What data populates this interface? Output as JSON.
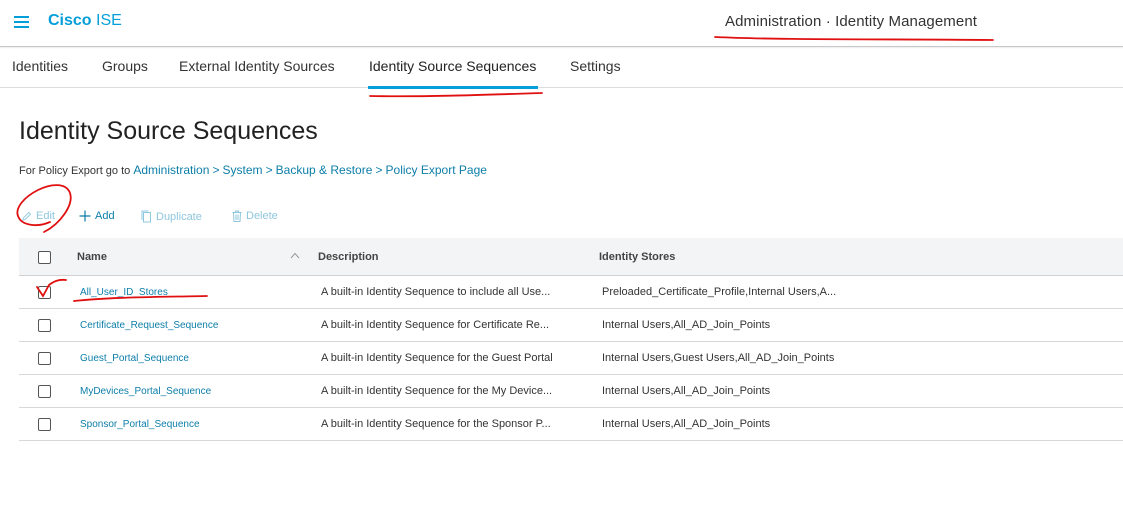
{
  "header": {
    "brand_bold": "Cisco",
    "brand_light": "ISE",
    "context": "Administration · Identity Management"
  },
  "tabs": [
    {
      "label": "Identities"
    },
    {
      "label": "Groups"
    },
    {
      "label": "External Identity Sources"
    },
    {
      "label": "Identity Source Sequences",
      "active": true
    },
    {
      "label": "Settings"
    }
  ],
  "page": {
    "title": "Identity Source Sequences",
    "policy_prefix": "For Policy Export go to",
    "policy_links": [
      "Administration",
      "System",
      "Backup & Restore",
      "Policy Export Page"
    ],
    "policy_separator": ">"
  },
  "toolbar": {
    "edit": "Edit",
    "add": "Add",
    "duplicate": "Duplicate",
    "delete": "Delete"
  },
  "table": {
    "columns": [
      "Name",
      "Description",
      "Identity Stores"
    ],
    "rows": [
      {
        "name": "All_User_ID_Stores",
        "description": "A built-in Identity Sequence to include all Use...",
        "stores": "Preloaded_Certificate_Profile,Internal Users,A..."
      },
      {
        "name": "Certificate_Request_Sequence",
        "description": "A built-in Identity Sequence for Certificate Re...",
        "stores": "Internal Users,All_AD_Join_Points"
      },
      {
        "name": "Guest_Portal_Sequence",
        "description": "A built-in Identity Sequence for the Guest Portal",
        "stores": "Internal Users,Guest Users,All_AD_Join_Points"
      },
      {
        "name": "MyDevices_Portal_Sequence",
        "description": "A built-in Identity Sequence for the My Device...",
        "stores": "Internal Users,All_AD_Join_Points"
      },
      {
        "name": "Sponsor_Portal_Sequence",
        "description": "A built-in Identity Sequence for the Sponsor P...",
        "stores": "Internal Users,All_AD_Join_Points"
      }
    ]
  },
  "colors": {
    "accent": "#049fd9",
    "link": "#0d7ea8",
    "annotation": "#e01010"
  }
}
